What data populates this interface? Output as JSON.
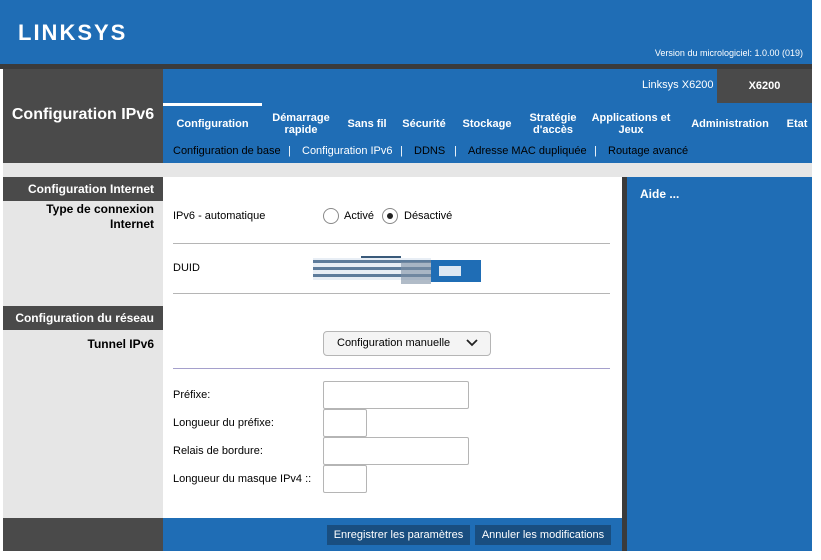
{
  "header": {
    "brand": "LINKSYS",
    "firmware": "Version du micrologiciel: 1.0.00 (019)"
  },
  "page_title": "Configuration IPv6",
  "model": {
    "name": "Linksys X6200",
    "code": "X6200"
  },
  "tabs": [
    {
      "label": "Configuration",
      "active": true
    },
    {
      "label": "Démarrage rapide"
    },
    {
      "label": "Sans fil"
    },
    {
      "label": "Sécurité"
    },
    {
      "label": "Stockage"
    },
    {
      "label": "Stratégie d'accès"
    },
    {
      "label": "Applications et Jeux"
    },
    {
      "label": "Administration"
    },
    {
      "label": "Etat"
    }
  ],
  "subnav": {
    "items": [
      {
        "label": "Configuration de base"
      },
      {
        "label": "Configuration IPv6",
        "active": true
      },
      {
        "label": "DDNS"
      },
      {
        "label": "Adresse MAC dupliquée"
      },
      {
        "label": "Routage avancé"
      }
    ],
    "separator": "|"
  },
  "sidebar": {
    "section_internet": "Configuration Internet",
    "connection_type": "Type de connexion Internet",
    "section_network": "Configuration du réseau",
    "tunnel": "Tunnel IPv6"
  },
  "form": {
    "ipv6_auto_label": "IPv6 - automatique",
    "radio_active": "Activé",
    "radio_inactive": "Désactivé",
    "radio_selected": "inactive",
    "duid_label": "DUID",
    "tunnel_select": "Configuration manuelle",
    "prefix_label": "Préfixe:",
    "prefix_length_label": "Longueur du préfixe:",
    "border_relay_label": "Relais de bordure:",
    "ipv4_mask_label": "Longueur du masque IPv4 ::",
    "prefix_value": "",
    "prefix_length_value": "",
    "border_relay_value": "",
    "ipv4_mask_value": ""
  },
  "help": {
    "title": "Aide ..."
  },
  "buttons": {
    "save": "Enregistrer les paramètres",
    "cancel": "Annuler les modifications"
  },
  "colors": {
    "brand_blue": "#1f6db5",
    "dark_gray": "#4a4a4a",
    "button_blue": "#194e80"
  }
}
